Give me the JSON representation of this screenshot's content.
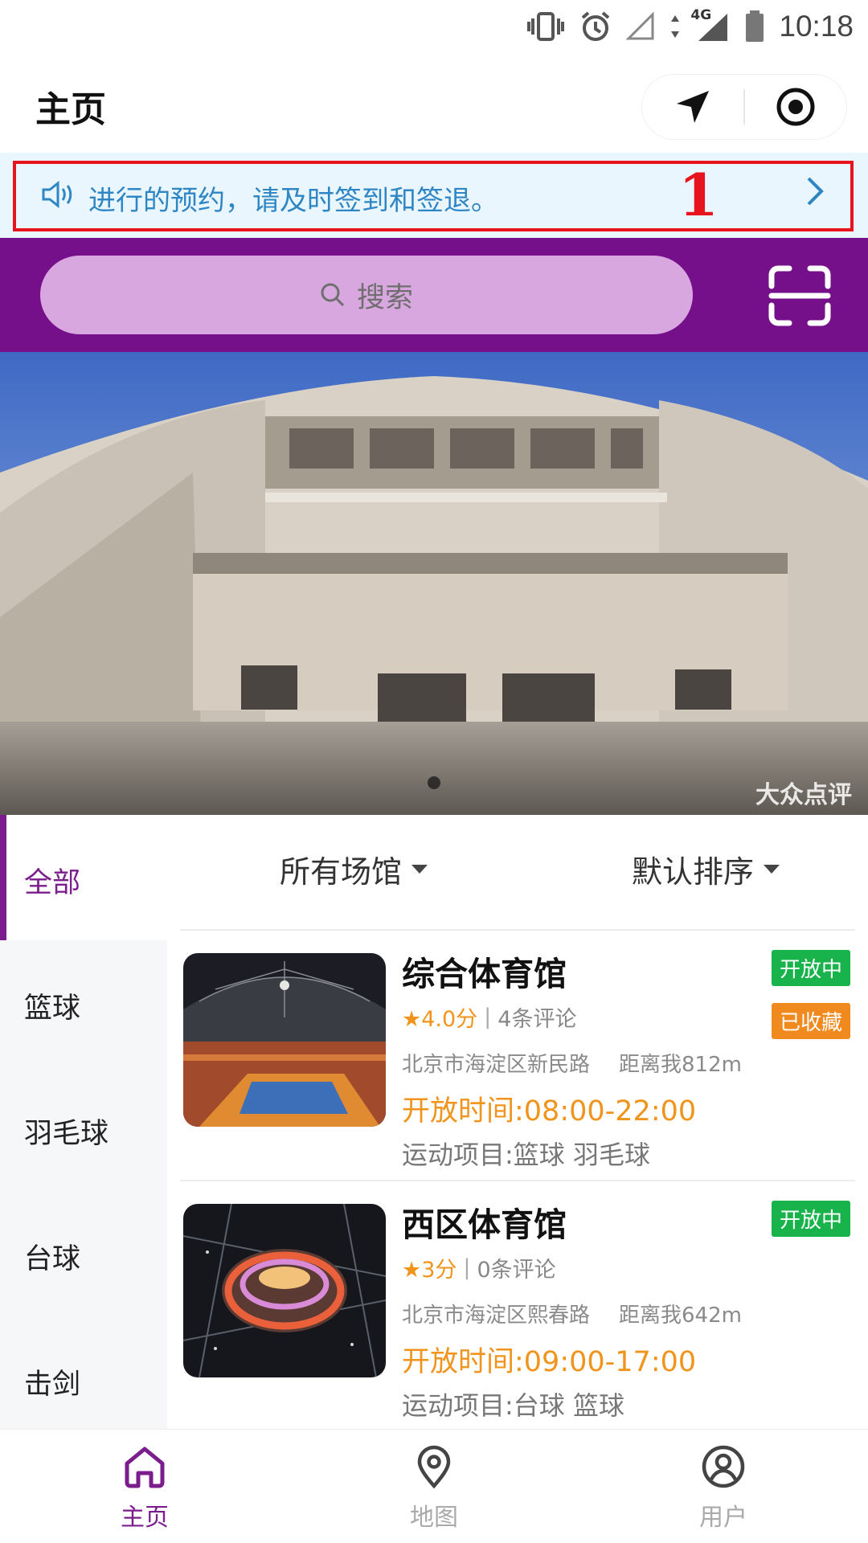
{
  "status_bar": {
    "time": "10:18",
    "network": "4G"
  },
  "header": {
    "title": "主页"
  },
  "notice": {
    "text": "进行的预约，请及时签到和签退。",
    "marker": "1"
  },
  "search": {
    "placeholder": "搜索"
  },
  "banner": {
    "watermark": "大众点评"
  },
  "sidebar": {
    "items": [
      {
        "label": "全部",
        "active": true
      },
      {
        "label": "篮球"
      },
      {
        "label": "羽毛球"
      },
      {
        "label": "台球"
      },
      {
        "label": "击剑"
      }
    ]
  },
  "filters": {
    "venue": "所有场馆",
    "sort": "默认排序"
  },
  "venues": [
    {
      "name": "综合体育馆",
      "rating": "★4.0分",
      "reviews": "4条评论",
      "address": "北京市海淀区新民路",
      "distance": "距离我812m",
      "hours": "开放时间:08:00-22:00",
      "sports": "运动项目:篮球 羽毛球",
      "status": "开放中",
      "saved": "已收藏"
    },
    {
      "name": "西区体育馆",
      "rating": "★3分",
      "reviews": "0条评论",
      "address": "北京市海淀区熙春路",
      "distance": "距离我642m",
      "hours": "开放时间:09:00-17:00",
      "sports": "运动项目:台球 篮球",
      "status": "开放中"
    }
  ],
  "tabbar": {
    "items": [
      {
        "label": "主页",
        "icon": "home-icon",
        "active": true
      },
      {
        "label": "地图",
        "icon": "map-pin-icon"
      },
      {
        "label": "用户",
        "icon": "user-icon"
      }
    ]
  },
  "colors": {
    "brand": "#76108a",
    "accent": "#7b1d8c",
    "open": "#19b34b",
    "saved": "#f08a1f",
    "notice_text": "#2f86c5",
    "highlight": "#e8141d",
    "hours": "#f0941c"
  }
}
